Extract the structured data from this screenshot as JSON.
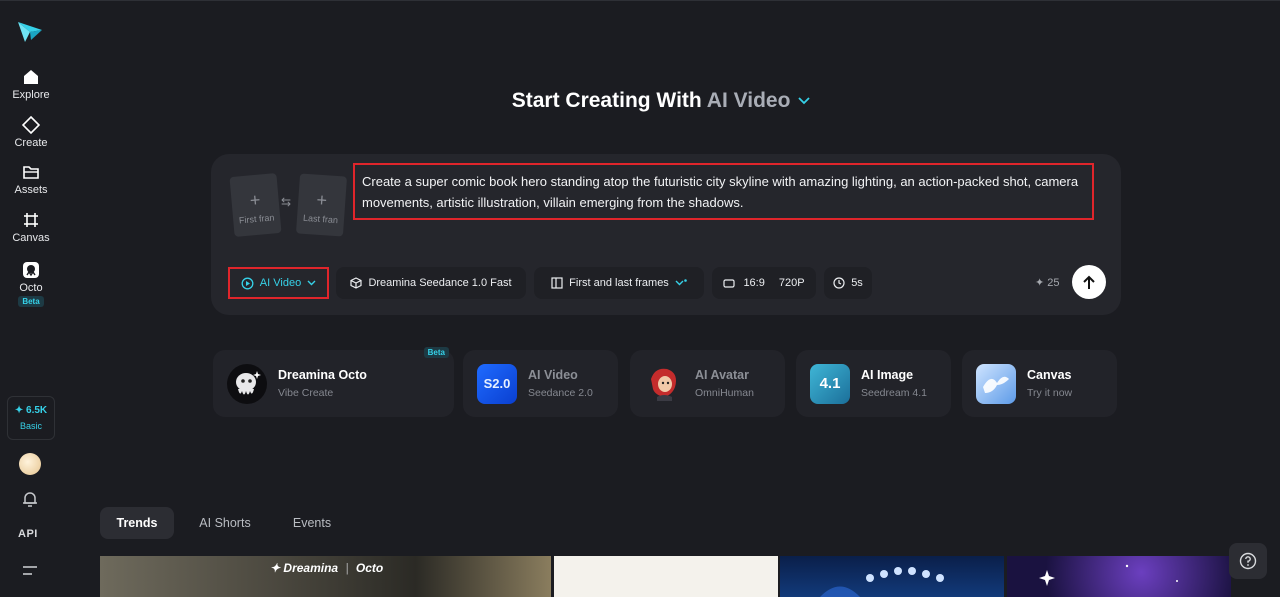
{
  "sidebar": {
    "items": [
      {
        "label": "Explore",
        "icon": "home-icon"
      },
      {
        "label": "Create",
        "icon": "diamond-icon"
      },
      {
        "label": "Assets",
        "icon": "folder-icon"
      },
      {
        "label": "Canvas",
        "icon": "canvas-grid-icon"
      },
      {
        "label": "Octo",
        "icon": "octo-icon",
        "badge": "Beta"
      }
    ],
    "credits": {
      "value": "✦ 6.5K",
      "plan": "Basic"
    },
    "api_label": "API"
  },
  "header": {
    "title": "Start Creating With",
    "accent": "AI Video"
  },
  "prompt": {
    "first_frame_label": "First fran",
    "last_frame_label": "Last fran",
    "text": "Create a super comic book hero standing atop the futuristic city skyline with amazing lighting, an action-packed shot, camera movements, artistic illustration, villain emerging from the shadows."
  },
  "toolbar": {
    "mode": "AI Video",
    "model": "Dreamina Seedance 1.0 Fast",
    "frames": "First and last frames",
    "ratio": "16:9",
    "resolution": "720P",
    "duration": "5s",
    "cost": "✦ 25"
  },
  "tools": [
    {
      "title": "Dreamina Octo",
      "sub": "Vibe Create",
      "badge": "Beta"
    },
    {
      "title": "AI Video",
      "sub": "Seedance 2.0",
      "icon_text": "S2.0"
    },
    {
      "title": "AI Avatar",
      "sub": "OmniHuman"
    },
    {
      "title": "AI Image",
      "sub": "Seedream 4.1",
      "icon_text": "4.1"
    },
    {
      "title": "Canvas",
      "sub": "Try it now"
    }
  ],
  "tabs": [
    {
      "label": "Trends",
      "active": true
    },
    {
      "label": "AI Shorts",
      "active": false
    },
    {
      "label": "Events",
      "active": false
    }
  ],
  "thumbnails": {
    "brand": "Dreamina",
    "brand2": "Octo"
  },
  "colors": {
    "accent": "#36d1e8",
    "background": "#1b1c21",
    "highlight_border": "#e0252b"
  }
}
